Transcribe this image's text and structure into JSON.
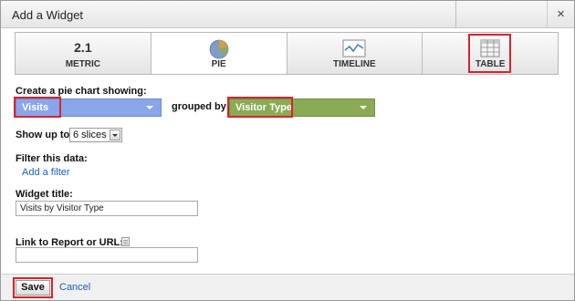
{
  "dialog": {
    "title": "Add a Widget",
    "close_glyph": "×"
  },
  "widget_types": [
    {
      "id": "metric",
      "label": "METRIC",
      "value": "2.1",
      "icon": "metric-icon"
    },
    {
      "id": "pie",
      "label": "PIE",
      "icon": "pie-chart-icon",
      "selected": true
    },
    {
      "id": "timeline",
      "label": "TIMELINE",
      "icon": "timeline-icon"
    },
    {
      "id": "table",
      "label": "TABLE",
      "icon": "table-icon"
    }
  ],
  "form": {
    "pie_prompt": "Create a pie chart showing:",
    "metric_value": "Visits",
    "grouped_by_label": "grouped by",
    "dimension_value": "Visitor Type",
    "show_up_to_label": "Show up to",
    "slices_value": "6 slices",
    "filter_label": "Filter this data:",
    "add_filter_link": "Add a filter",
    "widget_title_label": "Widget title:",
    "widget_title_value": "Visits by Visitor Type",
    "link_label": "Link to Report or URL:",
    "link_value": ""
  },
  "footer": {
    "save_label": "Save",
    "cancel_label": "Cancel"
  },
  "colors": {
    "metric_dropdown": "#8aa6ea",
    "dimension_dropdown": "#8aaa55",
    "highlight": "#d9232b",
    "link": "#1a5fb4"
  }
}
